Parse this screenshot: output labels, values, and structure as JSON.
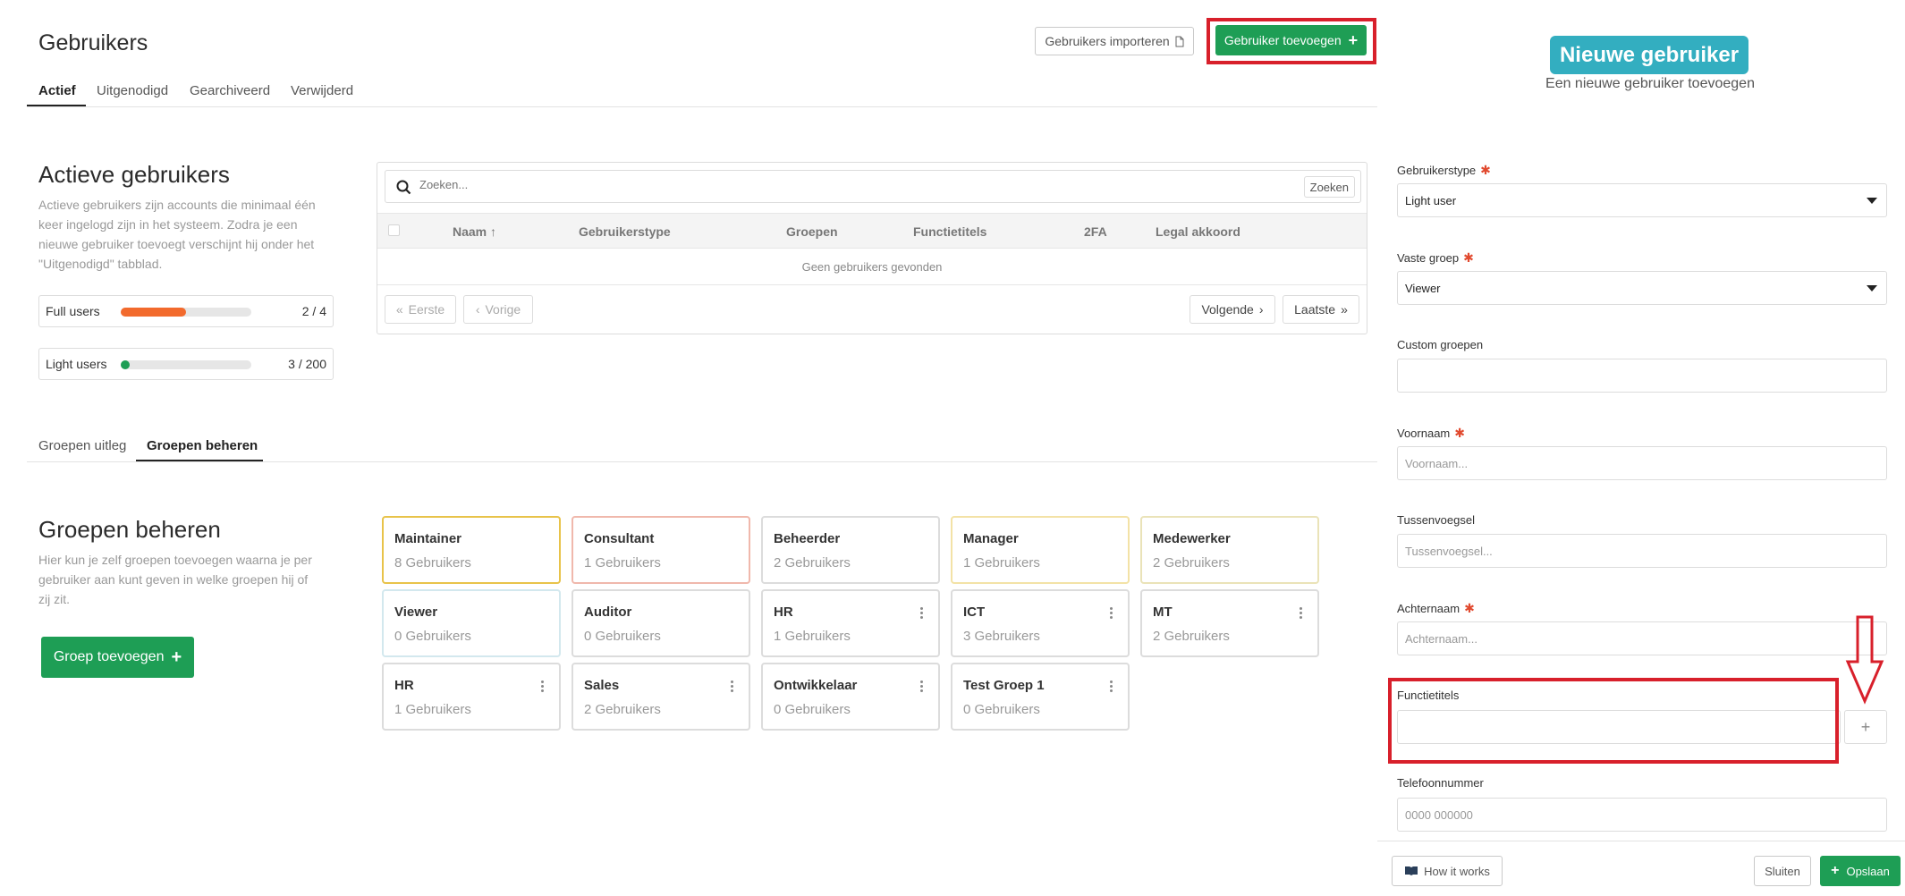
{
  "header": {
    "title": "Gebruikers",
    "import_button": "Gebruikers importeren",
    "add_button": "Gebruiker toevoegen"
  },
  "tabs": [
    {
      "label": "Actief",
      "active": true
    },
    {
      "label": "Uitgenodigd",
      "active": false
    },
    {
      "label": "Gearchiveerd",
      "active": false
    },
    {
      "label": "Verwijderd",
      "active": false
    }
  ],
  "active_users": {
    "title": "Actieve gebruikers",
    "description_lines": [
      "Actieve gebruikers zijn accounts die minimaal één",
      "keer ingelogd zijn in het systeem. Zodra je een",
      "nieuwe gebruiker toevoegt verschijnt hij onder het",
      "\"Uitgenodigd\" tabblad."
    ],
    "usage": [
      {
        "label": "Full users",
        "count": "2 / 4",
        "fraction": 0.5,
        "color": "#f26a2d"
      },
      {
        "label": "Light users",
        "count": "3 / 200",
        "fraction": 0.015,
        "color": "#1e9e55"
      }
    ]
  },
  "table": {
    "search_placeholder": "Zoeken...",
    "search_button": "Zoeken",
    "columns": [
      "Naam",
      "Gebruikerstype",
      "Groepen",
      "Functietitels",
      "2FA",
      "Legal akkoord"
    ],
    "empty_text": "Geen gebruikers gevonden",
    "pagination": {
      "first": "Eerste",
      "prev": "Vorige",
      "next": "Volgende",
      "last": "Laatste"
    }
  },
  "group_tabs": [
    {
      "label": "Groepen uitleg",
      "active": false
    },
    {
      "label": "Groepen beheren",
      "active": true
    }
  ],
  "groups_section": {
    "title": "Groepen beheren",
    "description_lines": [
      "Hier kun je zelf groepen toevoegen waarna je per",
      "gebruiker aan kunt geven in welke groepen hij of",
      "zij zit."
    ],
    "add_button": "Groep toevoegen"
  },
  "groups": [
    {
      "name": "Maintainer",
      "count": "8 Gebruikers",
      "border": "#e8c34a",
      "menu": false
    },
    {
      "name": "Consultant",
      "count": "1 Gebruikers",
      "border": "#f0b8ac",
      "menu": false
    },
    {
      "name": "Beheerder",
      "count": "2 Gebruikers",
      "border": "#dcdcdc",
      "menu": false
    },
    {
      "name": "Manager",
      "count": "1 Gebruikers",
      "border": "#f3e2a6",
      "menu": false
    },
    {
      "name": "Medewerker",
      "count": "2 Gebruikers",
      "border": "#eae3b8",
      "menu": false
    },
    {
      "name": "Viewer",
      "count": "0 Gebruikers",
      "border": "#d3e8ee",
      "menu": false
    },
    {
      "name": "Auditor",
      "count": "0 Gebruikers",
      "border": "#dcdcdc",
      "menu": false
    },
    {
      "name": "HR",
      "count": "1 Gebruikers",
      "border": "#dcdcdc",
      "menu": true
    },
    {
      "name": "ICT",
      "count": "3 Gebruikers",
      "border": "#dcdcdc",
      "menu": true
    },
    {
      "name": "MT",
      "count": "2 Gebruikers",
      "border": "#dcdcdc",
      "menu": true
    },
    {
      "name": "HR",
      "count": "1 Gebruikers",
      "border": "#dcdcdc",
      "menu": true
    },
    {
      "name": "Sales",
      "count": "2 Gebruikers",
      "border": "#dcdcdc",
      "menu": true
    },
    {
      "name": "Ontwikkelaar",
      "count": "0 Gebruikers",
      "border": "#dcdcdc",
      "menu": true
    },
    {
      "name": "Test Groep 1",
      "count": "0 Gebruikers",
      "border": "#dcdcdc",
      "menu": true
    }
  ],
  "panel": {
    "title": "Nieuwe gebruiker",
    "subtitle": "Een nieuwe gebruiker toevoegen",
    "fields": {
      "gebruikerstype": {
        "label": "Gebruikerstype",
        "value": "Light user"
      },
      "vaste_groep": {
        "label": "Vaste groep",
        "value": "Viewer"
      },
      "custom_groepen": {
        "label": "Custom groepen",
        "value": ""
      },
      "voornaam": {
        "label": "Voornaam",
        "placeholder": "Voornaam..."
      },
      "tussenvoegsel": {
        "label": "Tussenvoegsel",
        "placeholder": "Tussenvoegsel..."
      },
      "achternaam": {
        "label": "Achternaam",
        "placeholder": "Achternaam..."
      },
      "functietitels": {
        "label": "Functietitels",
        "value": ""
      },
      "telefoonnummer": {
        "label": "Telefoonnummer",
        "placeholder": "0000 000000"
      }
    },
    "footer": {
      "how_it_works": "How it works",
      "close": "Sluiten",
      "save": "Opslaan"
    }
  },
  "colors": {
    "brand_green": "#1e9e55",
    "panel_teal": "#33aec0",
    "annotation_red": "#d8202b",
    "required_star": "#e14a2f"
  }
}
